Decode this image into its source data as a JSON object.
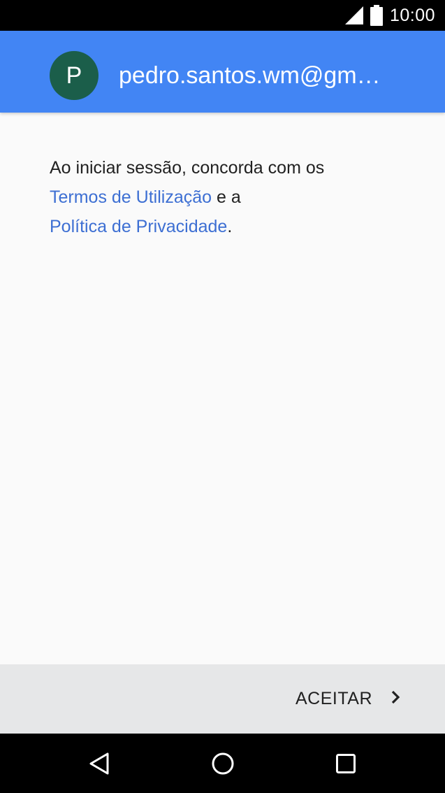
{
  "status_bar": {
    "time": "10:00",
    "icons": [
      "cell-signal-icon",
      "battery-icon"
    ]
  },
  "account": {
    "avatar_letter": "P",
    "email": "pedro.santos.wm@gm…"
  },
  "consent": {
    "text_before": "Ao iniciar sessão, concorda com os",
    "terms_link": "Termos de Utilização",
    "connector": "e a",
    "privacy_link": "Política de Privacidade",
    "end": "."
  },
  "footer": {
    "accept_label": "ACEITAR",
    "accept_icon": "chevron-right-icon"
  },
  "nav": {
    "icons": [
      "back-icon",
      "home-icon",
      "recents-icon"
    ]
  },
  "colors": {
    "header": "#4285f4",
    "avatar": "#1b5e4a",
    "link": "#3d6fd3",
    "footer": "#e6e7e8"
  }
}
